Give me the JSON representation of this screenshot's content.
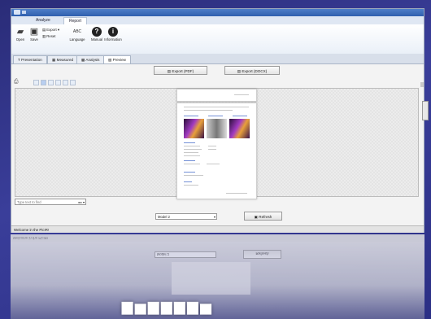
{
  "ribbon": {
    "tabs": [
      "Analyze",
      "Report"
    ],
    "active_tab": "Report",
    "buttons": [
      {
        "label": "Open",
        "icon": "folder-icon"
      },
      {
        "label": "Save",
        "icon": "save-icon"
      },
      {
        "label": "Export ▾",
        "icon": "export-icon"
      },
      {
        "label": "Reset",
        "icon": "reset-icon"
      },
      {
        "label": "Language",
        "icon": "language-icon",
        "glyph": "ABC"
      },
      {
        "label": "Manual",
        "icon": "help-icon"
      },
      {
        "label": "Information",
        "icon": "info-icon"
      }
    ]
  },
  "doc_tabs": [
    {
      "label": "Presentation",
      "icon": "presentation-icon"
    },
    {
      "label": "Measured",
      "icon": "measured-icon"
    },
    {
      "label": "Analysis",
      "icon": "analysis-icon"
    },
    {
      "label": "Preview",
      "icon": "preview-icon",
      "active": true
    }
  ],
  "export": {
    "pdf_label": "Export (PDF)",
    "docx_label": "Export (DOCX)"
  },
  "preview": {
    "search_placeholder": "Type text to find"
  },
  "template": {
    "selected": "Model 2",
    "refresh_label": "Refresh"
  },
  "status": {
    "text": "Welcome in the PicIR!"
  },
  "colors": {
    "desktop": "#2f3390",
    "titlebar": "#3d6dbd",
    "accent_page_text": "#7390d6"
  }
}
